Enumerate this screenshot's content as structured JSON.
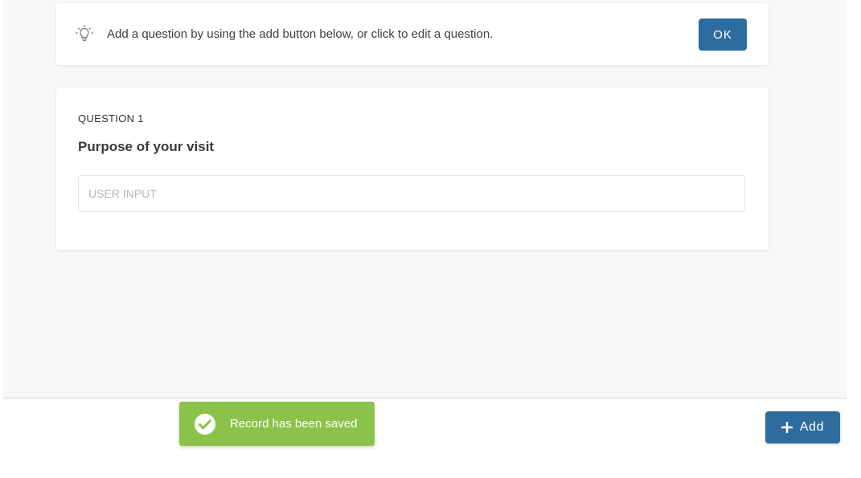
{
  "tip": {
    "icon": "lightbulb-icon",
    "text": "Add a question by using the add button below, or click to edit a question.",
    "ok_label": "OK"
  },
  "question": {
    "number_label": "QUESTION 1",
    "title": "Purpose of your visit",
    "input_placeholder": "USER INPUT",
    "input_value": ""
  },
  "toast": {
    "icon": "check-circle-icon",
    "message": "Record has been saved"
  },
  "footer": {
    "add_icon": "plus-icon",
    "add_label": "Add"
  },
  "colors": {
    "primary": "#2e6c9e",
    "success": "#8bc34a",
    "canvas": "#f8f8f8"
  }
}
